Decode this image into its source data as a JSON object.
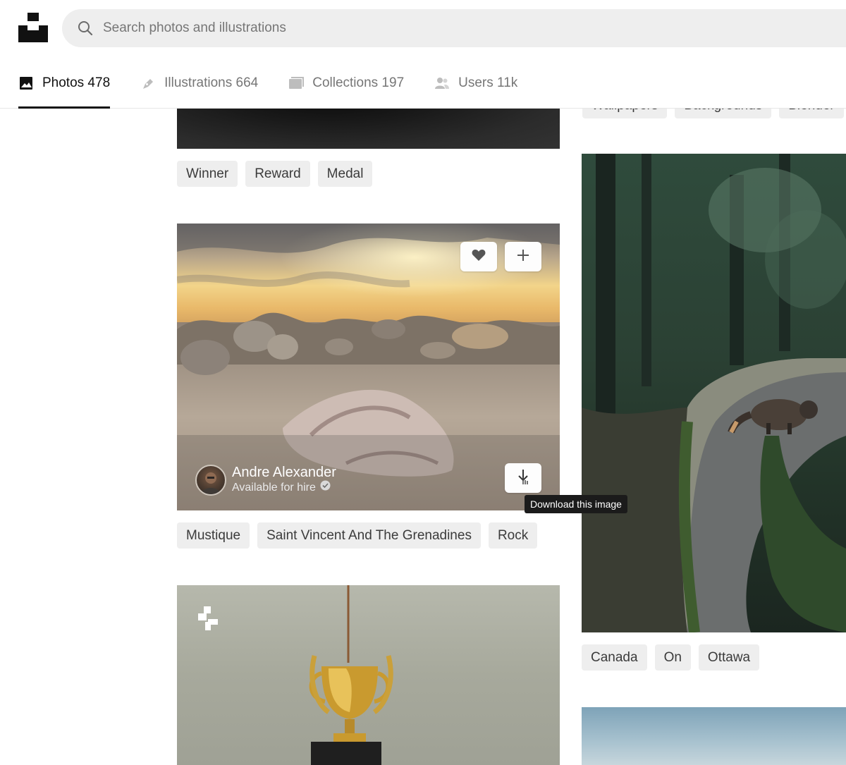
{
  "search": {
    "placeholder": "Search photos and illustrations"
  },
  "tabs": [
    {
      "label": "Photos 478",
      "icon": "photo-icon",
      "active": true
    },
    {
      "label": "Illustrations 664",
      "icon": "pen-icon",
      "active": false
    },
    {
      "label": "Collections 197",
      "icon": "collections-icon",
      "active": false
    },
    {
      "label": "Users 11k",
      "icon": "users-icon",
      "active": false
    }
  ],
  "top_right_tags": [
    "Wallpapers",
    "Backgrounds",
    "Blender"
  ],
  "card1": {
    "tags": [
      "Winner",
      "Reward",
      "Medal"
    ]
  },
  "card2": {
    "author": "Andre Alexander",
    "author_status": "Available for hire",
    "tags": [
      "Mustique",
      "Saint Vincent And The Grenadines",
      "Rock"
    ],
    "tooltip": "Download this image"
  },
  "card3": {
    "tags": [
      "Canada",
      "On",
      "Ottawa"
    ]
  },
  "colors": {
    "tag_bg": "#eeeeee",
    "search_bg": "#eeeeee",
    "active_tab": "#111111",
    "muted": "#767676"
  }
}
